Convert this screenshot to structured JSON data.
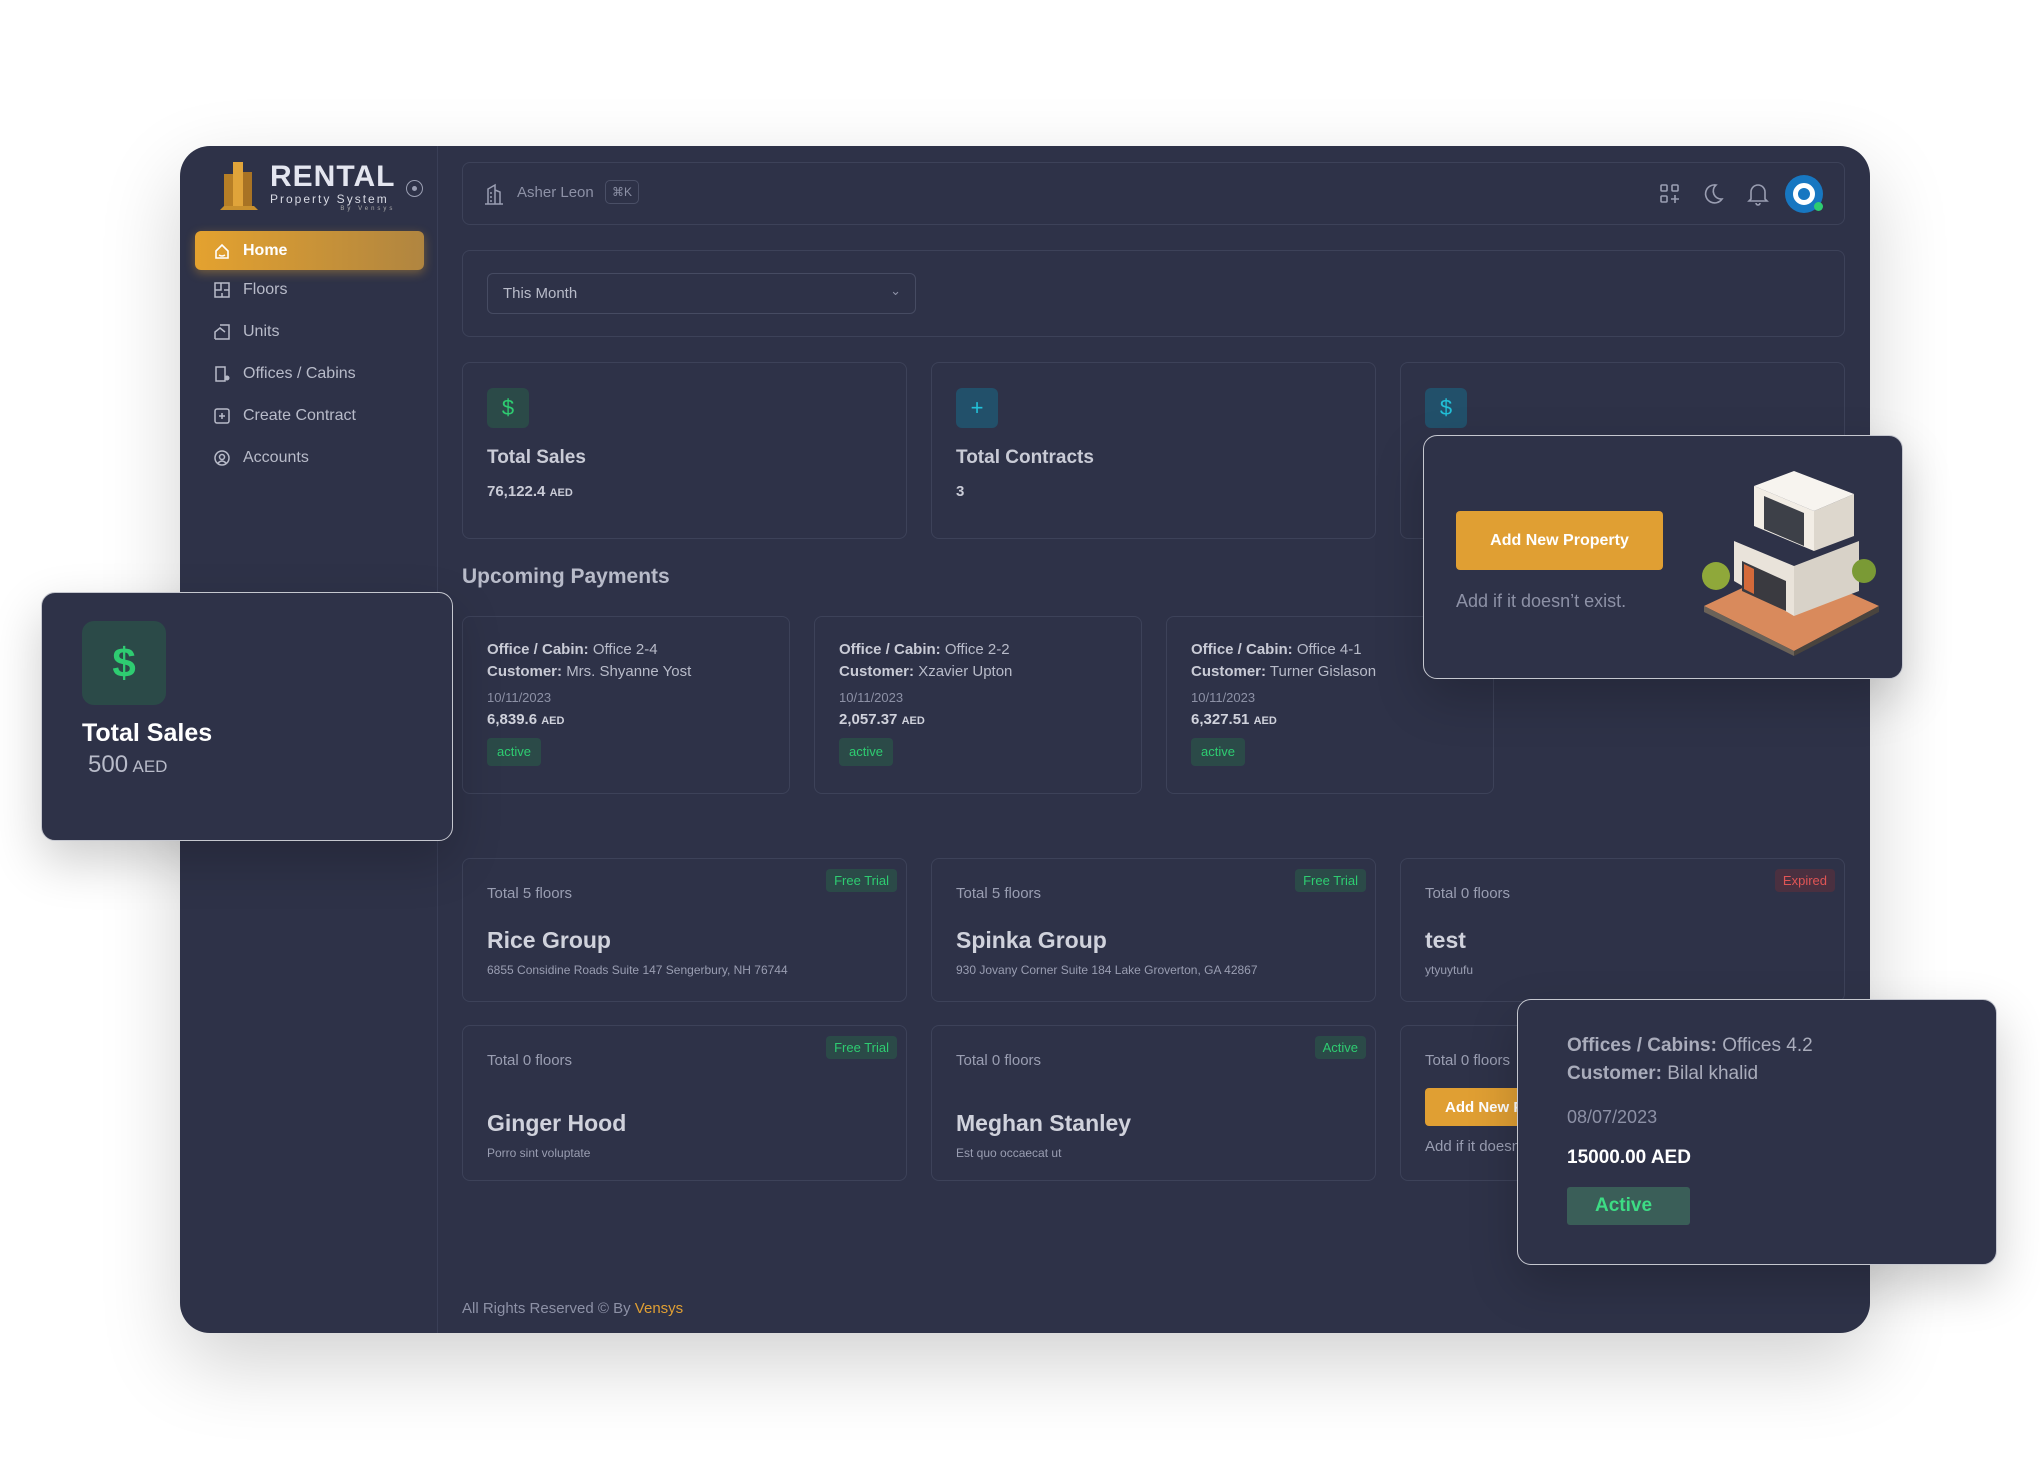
{
  "brand": {
    "name": "RENTAL",
    "tagline": "Property System",
    "by": "By Vensys"
  },
  "sidebar": {
    "items": [
      {
        "label": "Home",
        "icon": "home-icon",
        "active": true
      },
      {
        "label": "Floors",
        "icon": "floor-plan-icon"
      },
      {
        "label": "Units",
        "icon": "units-icon"
      },
      {
        "label": "Offices / Cabins",
        "icon": "office-building-icon"
      },
      {
        "label": "Create Contract",
        "icon": "plus-square-icon"
      },
      {
        "label": "Accounts",
        "icon": "user-circle-icon"
      }
    ]
  },
  "header": {
    "user": "Asher Leon",
    "shortcut": "⌘K",
    "icons": [
      "apps-add-icon",
      "moon-icon",
      "bell-icon",
      "avatar"
    ]
  },
  "filter": {
    "selected": "This Month"
  },
  "stats": [
    {
      "title": "Total Sales",
      "value": "76,122.4",
      "unit": "AED",
      "icon": "dollar-icon",
      "color": "#2ecc71"
    },
    {
      "title": "Total Contracts",
      "value": "3",
      "icon": "plus-icon",
      "color": "#22c0d8"
    },
    {
      "icon": "dollar-icon",
      "color": "#22c0d8"
    }
  ],
  "upcoming": {
    "title": "Upcoming Payments",
    "office_label": "Office / Cabin:",
    "customer_label": "Customer:",
    "items": [
      {
        "office": "Office 2-4",
        "customer": "Mrs. Shyanne Yost",
        "date": "10/11/2023",
        "amount": "6,839.6",
        "unit": "AED",
        "status": "active"
      },
      {
        "office": "Office 2-2",
        "customer": "Xzavier Upton",
        "date": "10/11/2023",
        "amount": "2,057.37",
        "unit": "AED",
        "status": "active"
      },
      {
        "office": "Office 4-1",
        "customer": "Turner Gislason",
        "date": "10/11/2023",
        "amount": "6,327.51",
        "unit": "AED",
        "status": "active"
      }
    ]
  },
  "properties": [
    {
      "floors": "Total 5 floors",
      "name": "Rice Group",
      "address": "6855 Considine Roads Suite 147 Sengerbury, NH 76744",
      "badge": "Free Trial"
    },
    {
      "floors": "Total 5 floors",
      "name": "Spinka Group",
      "address": "930 Jovany Corner Suite 184 Lake Groverton, GA 42867",
      "badge": "Free Trial"
    },
    {
      "floors": "Total 0 floors",
      "name": "test",
      "address": "ytyuytufu",
      "badge": "Expired"
    },
    {
      "floors": "Total 0 floors",
      "name": "Ginger Hood",
      "address": "Porro sint voluptate",
      "badge": "Free Trial"
    },
    {
      "floors": "Total 0 floors",
      "name": "Meghan Stanley",
      "address": "Est quo occaecat ut",
      "badge": "Active"
    }
  ],
  "add_card_inline": {
    "floors": "Total 0 floors",
    "button": "Add New Property",
    "hint": "Add if it doesn't exist."
  },
  "footer": {
    "text": "All Rights Reserved © By",
    "link": "Vensys"
  },
  "float_sales": {
    "title": "Total Sales",
    "value": "500",
    "unit": "AED"
  },
  "float_add": {
    "button": "Add New Property",
    "hint": "Add if it doesn’t exist."
  },
  "float_contract": {
    "office_label": "Offices / Cabins:",
    "office": "Offices 4.2",
    "customer_label": "Customer:",
    "customer": "Bilal khalid",
    "date": "08/07/2023",
    "amount": "15000.00 AED",
    "status": "Active"
  },
  "colors": {
    "bg": "#2e3248",
    "accent": "#e09f33",
    "success": "#2ecc71",
    "danger": "#e05555"
  }
}
